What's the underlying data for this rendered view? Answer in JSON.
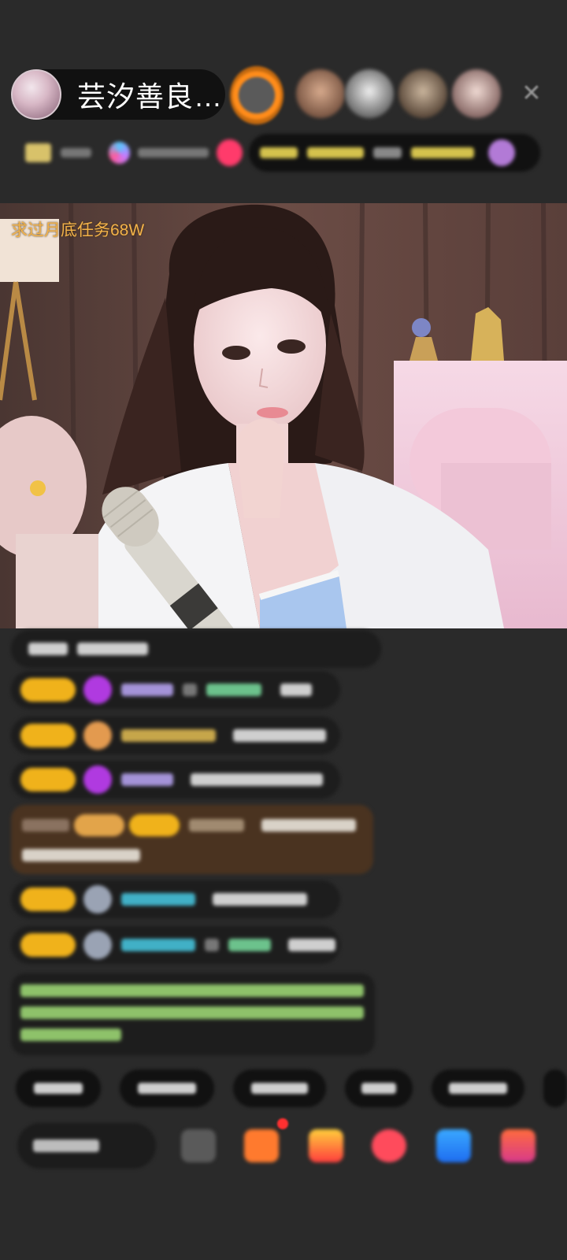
{
  "header": {
    "host_name": "芸汐善良…",
    "close_icon_glyph": "✕"
  },
  "video": {
    "overlay_text": "求过月底任务68W"
  },
  "colors": {
    "overlay_text": "#f3b24a",
    "badge": "#f0b21b",
    "background": "#2a2a2a"
  },
  "icons": [
    "close-icon",
    "emoji-icon",
    "gift-box-icon",
    "treasure-icon",
    "heart-icon",
    "game-icon",
    "more-icon"
  ]
}
